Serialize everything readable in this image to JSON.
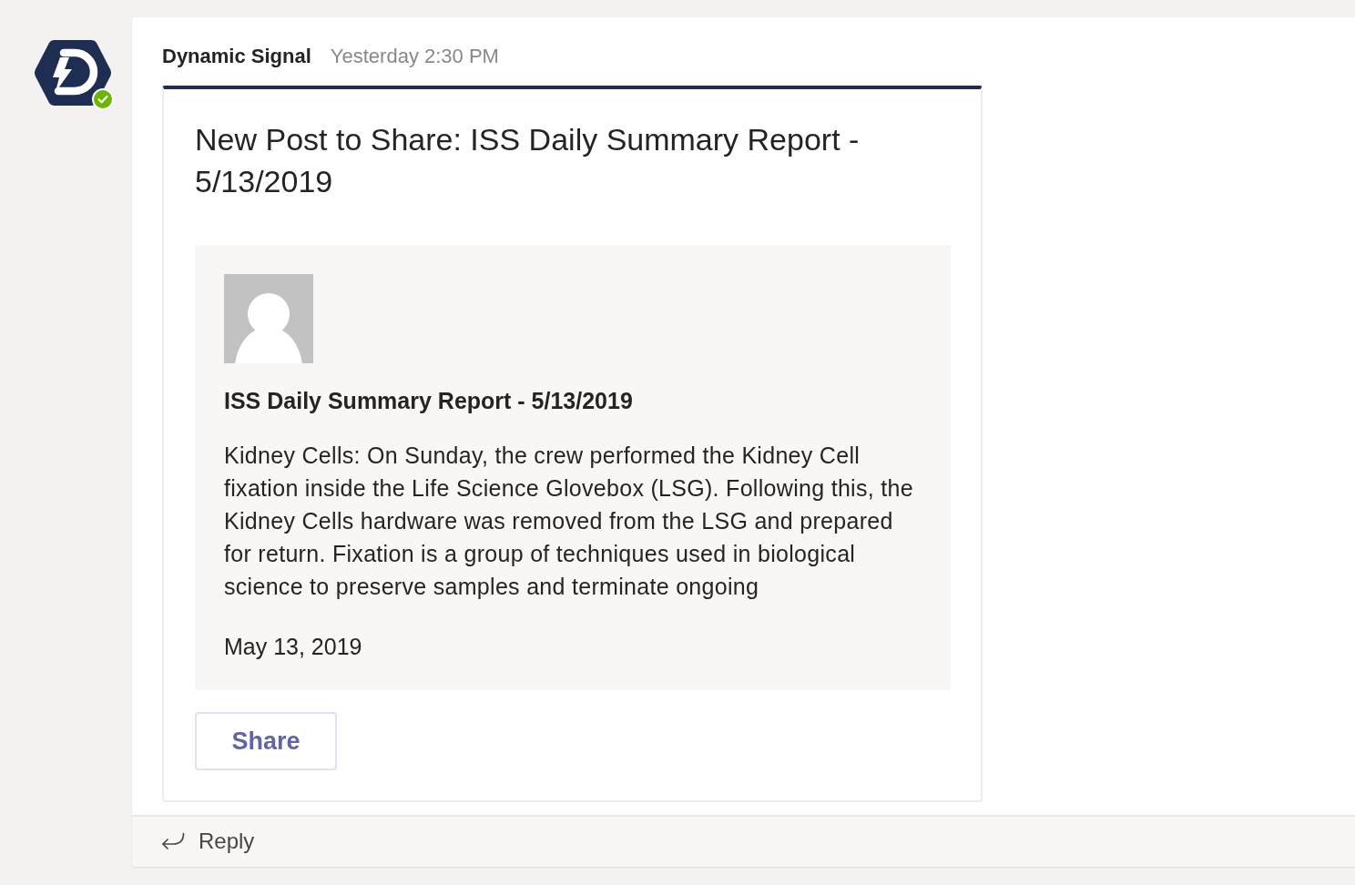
{
  "message": {
    "sender": "Dynamic Signal",
    "online": true,
    "timestamp": "Yesterday 2:30 PM"
  },
  "card": {
    "title": "New Post to Share: ISS Daily Summary Report - 5/13/2019",
    "post": {
      "title": "ISS Daily Summary Report - 5/13/2019",
      "excerpt": "Kidney Cells: On Sunday, the crew performed the Kidney Cell fixation inside the Life Science Glovebox (LSG). Following this, the Kidney Cells hardware was removed from the LSG and prepared for return. Fixation is a group of techniques used in biological science to preserve samples and terminate ongoing",
      "date": "May 13, 2019"
    },
    "actions": [
      {
        "label": "Share"
      }
    ]
  },
  "reply": {
    "label": "Reply"
  }
}
